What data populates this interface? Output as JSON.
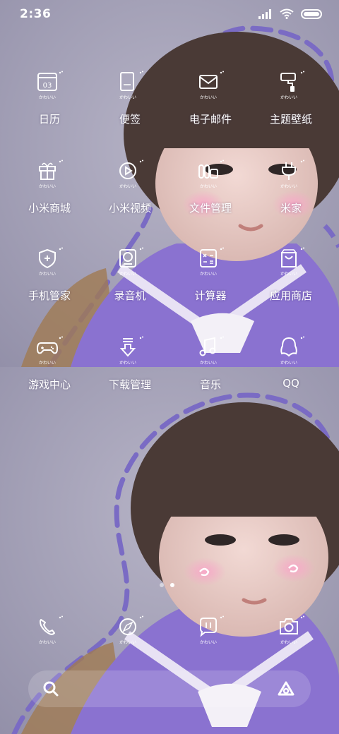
{
  "status": {
    "time": "2:36"
  },
  "badge_text": "かわいい",
  "apps": [
    {
      "label": "日历",
      "icon": "calendar-icon",
      "icon_text": "03"
    },
    {
      "label": "便签",
      "icon": "notes-icon"
    },
    {
      "label": "电子邮件",
      "icon": "email-icon"
    },
    {
      "label": "主题壁纸",
      "icon": "theme-brush-icon"
    },
    {
      "label": "小米商城",
      "icon": "gift-store-icon"
    },
    {
      "label": "小米视频",
      "icon": "video-play-icon"
    },
    {
      "label": "文件管理",
      "icon": "file-manager-icon"
    },
    {
      "label": "米家",
      "icon": "plug-icon"
    },
    {
      "label": "手机管家",
      "icon": "shield-icon"
    },
    {
      "label": "录音机",
      "icon": "recorder-icon"
    },
    {
      "label": "计算器",
      "icon": "calculator-icon"
    },
    {
      "label": "应用商店",
      "icon": "app-store-bag-icon"
    },
    {
      "label": "游戏中心",
      "icon": "gamepad-icon"
    },
    {
      "label": "下载管理",
      "icon": "download-icon"
    },
    {
      "label": "音乐",
      "icon": "music-note-icon"
    },
    {
      "label": "QQ",
      "icon": "qq-penguin-icon"
    }
  ],
  "dock": [
    {
      "icon": "phone-icon"
    },
    {
      "icon": "compass-browser-icon"
    },
    {
      "icon": "message-icon"
    },
    {
      "icon": "camera-icon"
    }
  ],
  "search_bar": {
    "left_icon": "search-icon",
    "right_icon": "assistant-icon"
  },
  "pages": {
    "count": 2,
    "active": 2
  },
  "colors": {
    "dress_purple": "#8a72d0",
    "dashed_line": "#7a6bc4",
    "background": "#9d9ab1"
  }
}
